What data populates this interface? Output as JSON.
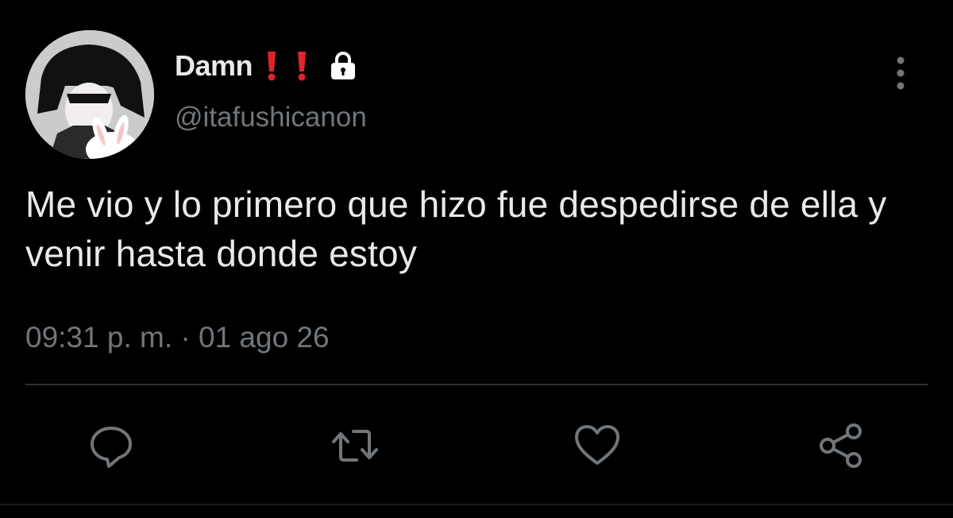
{
  "user": {
    "display_name": "Damn",
    "handle": "@itafushicanon",
    "avatar_icon": "anime-avatar-with-bunny",
    "badges": [
      "red-exclamation-icon",
      "red-exclamation-icon",
      "lock-icon"
    ]
  },
  "tweet": {
    "text": "Me vio y lo primero que hizo fue despedirse de ella y venir hasta donde estoy",
    "timestamp": "09:31 p. m. · 01 ago 26"
  },
  "actions": [
    {
      "name": "reply",
      "icon": "comment-bubble-icon"
    },
    {
      "name": "retweet",
      "icon": "retweet-icon"
    },
    {
      "name": "like",
      "icon": "heart-icon"
    },
    {
      "name": "share",
      "icon": "share-icon"
    }
  ],
  "colors": {
    "background": "#000000",
    "primary_text": "#e7e9ea",
    "secondary_text": "#71767b",
    "divider": "#2f3336",
    "exclamation": "#e0242c"
  }
}
